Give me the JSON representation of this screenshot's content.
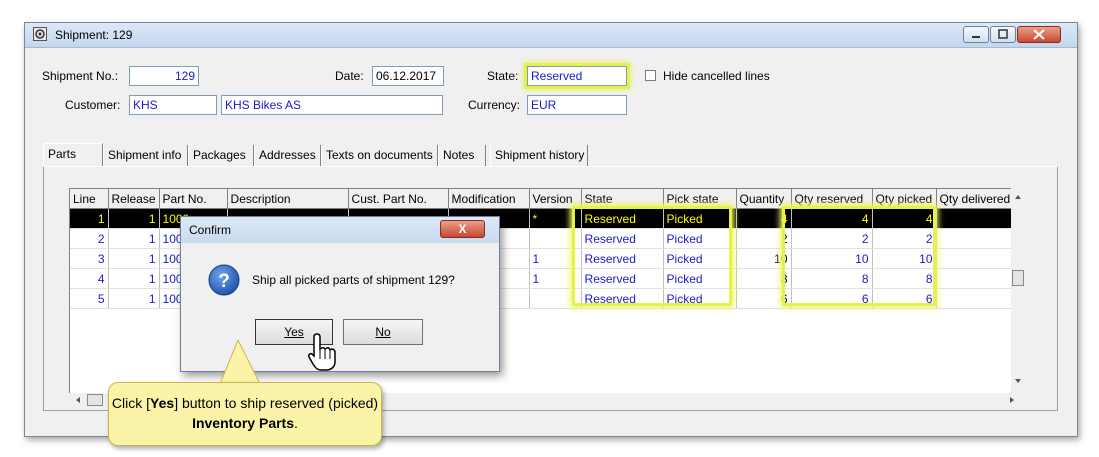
{
  "window": {
    "title": "Shipment: 129"
  },
  "header": {
    "shipment_no_label": "Shipment No.:",
    "shipment_no": "129",
    "date_label": "Date:",
    "date": "06.12.2017",
    "state_label": "State:",
    "state": "Reserved",
    "hide_cancelled_label": "Hide cancelled lines",
    "customer_label": "Customer:",
    "customer_code": "KHS",
    "customer_name": "KHS Bikes AS",
    "currency_label": "Currency:",
    "currency": "EUR"
  },
  "tabs": [
    "Parts",
    "Shipment info",
    "Packages",
    "Addresses",
    "Texts on documents",
    "Notes",
    "Shipment history"
  ],
  "grid": {
    "columns": [
      "Line",
      "Release",
      "Part No.",
      "Description",
      "Cust. Part No.",
      "Modification",
      "Version",
      "State",
      "Pick state",
      "Quantity",
      "Qty reserved",
      "Qty picked",
      "Qty delivered"
    ],
    "rows": [
      {
        "line": "1",
        "release": "1",
        "part": "1000",
        "version": "*",
        "state": "Reserved",
        "pick": "Picked",
        "qty": "4",
        "reserved": "4",
        "picked": "4"
      },
      {
        "line": "2",
        "release": "1",
        "part": "100",
        "version": "",
        "state": "Reserved",
        "pick": "Picked",
        "qty": "2",
        "reserved": "2",
        "picked": "2"
      },
      {
        "line": "3",
        "release": "1",
        "part": "100",
        "version": "1",
        "state": "Reserved",
        "pick": "Picked",
        "qty": "10",
        "reserved": "10",
        "picked": "10"
      },
      {
        "line": "4",
        "release": "1",
        "part": "100",
        "version": "1",
        "state": "Reserved",
        "pick": "Picked",
        "qty": "8",
        "reserved": "8",
        "picked": "8"
      },
      {
        "line": "5",
        "release": "1",
        "part": "100",
        "version": "",
        "state": "Reserved",
        "pick": "Picked",
        "qty": "6",
        "reserved": "6",
        "picked": "6"
      }
    ]
  },
  "dialog": {
    "title": "Confirm",
    "close_label": "X",
    "message": "Ship all picked parts of shipment 129?",
    "yes_label": "Yes",
    "no_label": "No"
  },
  "callout": {
    "part1": "Click [",
    "bold1": "Yes",
    "part2": "] button to ship reserved (picked) ",
    "bold2": "Inventory Parts",
    "part3": "."
  },
  "colors": {
    "highlight": "#e6f24a",
    "link_blue": "#1a1acc",
    "callout_bg": "#fbf3a8"
  }
}
